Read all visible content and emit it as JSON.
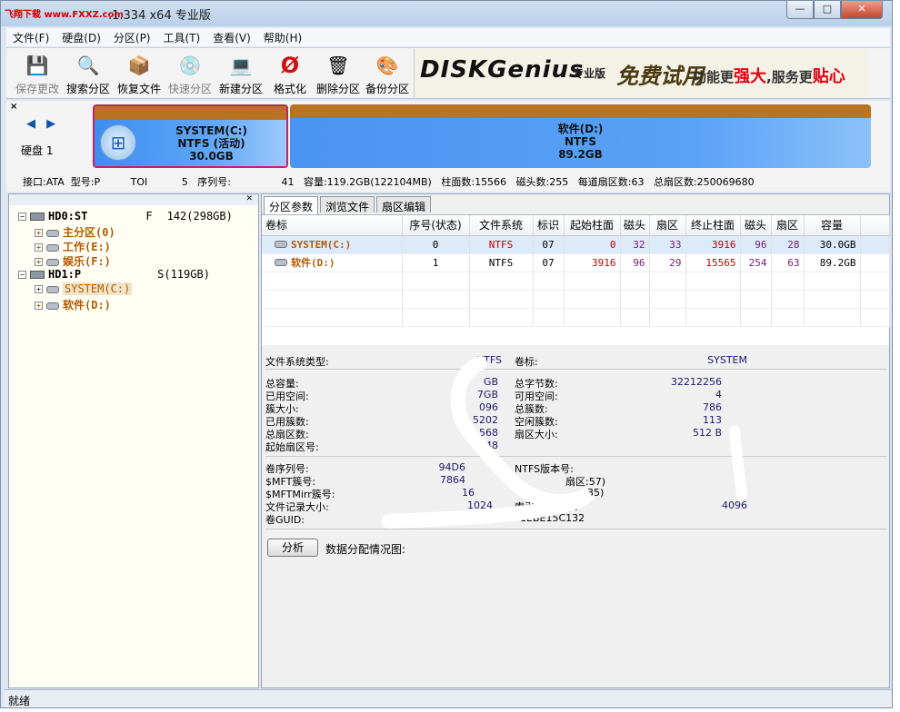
{
  "title": {
    "logo_text": "飞翔下载 www.FXXZ.com",
    "text": ".1.334 x64 专业版",
    "minimize": "—",
    "maximize": "□",
    "close": "✕"
  },
  "menu": [
    "文件(F)",
    "硬盘(D)",
    "分区(P)",
    "工具(T)",
    "查看(V)",
    "帮助(H)"
  ],
  "toolbar": [
    {
      "label": "保存更改",
      "icon": "save-icon",
      "glyph": "💾",
      "disabled": true
    },
    {
      "label": "搜索分区",
      "icon": "search-icon",
      "glyph": "🔍",
      "disabled": false
    },
    {
      "label": "恢复文件",
      "icon": "recover-files-icon",
      "glyph": "📦",
      "disabled": false
    },
    {
      "label": "快速分区",
      "icon": "quick-partition-icon",
      "glyph": "💿",
      "disabled": true
    },
    {
      "label": "新建分区",
      "icon": "new-partition-icon",
      "glyph": "💻",
      "disabled": false
    },
    {
      "label": "格式化",
      "icon": "format-icon",
      "glyph": "Ø",
      "disabled": false
    },
    {
      "label": "删除分区",
      "icon": "delete-partition-icon",
      "glyph": "🗑",
      "disabled": false
    },
    {
      "label": "备份分区",
      "icon": "backup-partition-icon",
      "glyph": "🎨",
      "disabled": false
    }
  ],
  "banner": {
    "brand": "DISKGenius",
    "edition": "专业版",
    "trial": "免费试用",
    "slogan_pre": "功能更",
    "slogan_em1": "强大",
    "slogan_mid": ",服务更",
    "slogan_em2": "贴心"
  },
  "diskmap": {
    "close": "×",
    "arrows": "◀ ▶",
    "disk_label": "硬盘 1",
    "partitions": [
      {
        "name": "SYSTEM(C:)",
        "fs": "NTFS (活动)",
        "size": "30.0GB"
      },
      {
        "name": "软件(D:)",
        "fs": "NTFS",
        "size": "89.2GB"
      }
    ]
  },
  "diskinfo": {
    "interface": "接口:ATA",
    "model": "型号:P",
    "model_tail": "TOI",
    "model_tail2": "5",
    "serial": "序列号:",
    "serial_tail": "41",
    "capacity": "容量:119.2GB(122104MB)",
    "cylinders": "柱面数:15566",
    "heads": "磁头数:255",
    "sectors_per_track": "每道扇区数:63",
    "total_sectors": "总扇区数:250069680"
  },
  "tree": {
    "header_pin": "✕",
    "hd0": "HD0:ST",
    "hd0_tail": "142(298GB)",
    "hd0_prefix_letter": "F",
    "hd0_children": [
      "主分区(0)",
      "工作(E:)",
      "娱乐(F:)"
    ],
    "hd1": "HD1:P",
    "hd1_tail": "S(119GB)",
    "hd1_children": [
      "SYSTEM(C:)",
      "软件(D:)"
    ]
  },
  "tabs": [
    "分区参数",
    "浏览文件",
    "扇区编辑"
  ],
  "table": {
    "headers": [
      "卷标",
      "序号(状态)",
      "文件系统",
      "标识",
      "起始柱面",
      "磁头",
      "扇区",
      "终止柱面",
      "磁头",
      "扇区",
      "容量"
    ],
    "rows": [
      {
        "label": "SYSTEM(C:)",
        "index": "0",
        "fs": "NTFS",
        "id": "07",
        "start_cyl": "0",
        "start_head": "32",
        "start_sec": "33",
        "end_cyl": "3916",
        "end_head": "96",
        "end_sec": "28",
        "capacity": "30.0GB"
      },
      {
        "label": "软件(D:)",
        "index": "1",
        "fs": "NTFS",
        "id": "07",
        "start_cyl": "3916",
        "start_head": "96",
        "start_sec": "29",
        "end_cyl": "15565",
        "end_head": "254",
        "end_sec": "63",
        "capacity": "89.2GB"
      }
    ]
  },
  "details": {
    "fs_type_label": "文件系统类型:",
    "fs_type_value": "NTFS",
    "volume_label_label": "卷标:",
    "volume_label_value": "SYSTEM",
    "left1": [
      "总容量:",
      "已用空间:",
      "簇大小:",
      "已用簇数:",
      "总扇区数:",
      "起始扇区号:"
    ],
    "left1_values": [
      "GB",
      "7GB",
      "096",
      "5202",
      "568",
      "048"
    ],
    "right1": [
      "总字节数:",
      "可用空间:",
      "总簇数:",
      "空闲簇数:",
      "扇区大小:"
    ],
    "right1_values": [
      "32212256",
      "4",
      "786",
      "113",
      "512 B"
    ],
    "left2": [
      "卷序列号:",
      "$MFT簇号:",
      "$MFTMirr簇号:",
      "文件记录大小:",
      "卷GUID:"
    ],
    "left2_values": [
      "94D6",
      "7864",
      "16",
      "1024",
      ""
    ],
    "right2_labels": [
      "NTFS版本号:",
      "扇区:57)",
      "35)",
      "索引记录大小:",
      "1EBE15C132"
    ],
    "right2_values": [
      "",
      "",
      "",
      "4096",
      ""
    ]
  },
  "analyze": {
    "button": "分析",
    "label": "数据分配情况图:"
  },
  "status": "就绪"
}
